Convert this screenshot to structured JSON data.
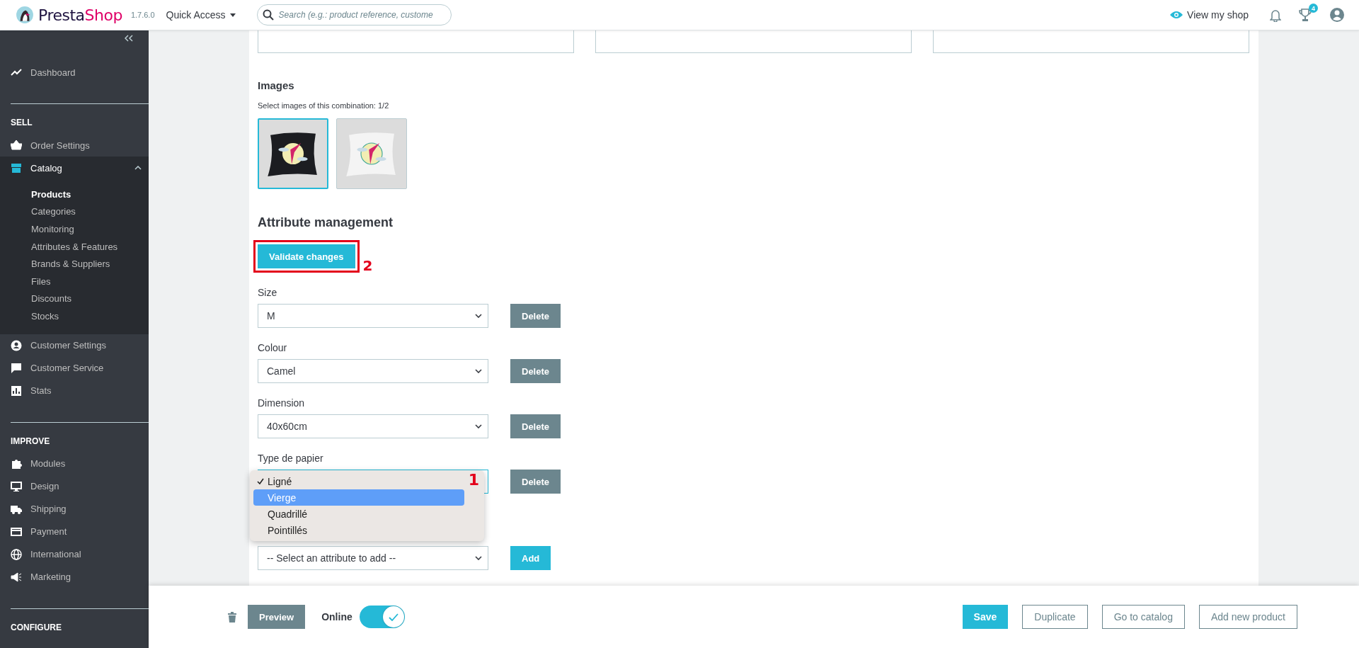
{
  "header": {
    "brand_first": "Presta",
    "brand_second": "Shop",
    "version": "1.7.6.0",
    "quick_access": "Quick Access",
    "search": {
      "placeholder": "Search (e.g.: product reference, custome"
    },
    "view_shop": "View my shop",
    "notification_count": "4"
  },
  "sidebar": {
    "groups": [
      {
        "items": [
          {
            "label": "Dashboard",
            "selected": false
          }
        ]
      },
      {
        "title": "SELL",
        "items": [
          {
            "label": "Order Settings",
            "selected": false
          },
          {
            "label": "Catalog",
            "selected": true,
            "expanded": true,
            "children": [
              {
                "label": "Products",
                "selected": true
              },
              {
                "label": "Categories",
                "selected": false
              },
              {
                "label": "Monitoring",
                "selected": false
              },
              {
                "label": "Attributes & Features",
                "selected": false
              },
              {
                "label": "Brands & Suppliers",
                "selected": false
              },
              {
                "label": "Files",
                "selected": false
              },
              {
                "label": "Discounts",
                "selected": false
              },
              {
                "label": "Stocks",
                "selected": false
              }
            ]
          },
          {
            "label": "Customer Settings",
            "selected": false
          },
          {
            "label": "Customer Service",
            "selected": false
          },
          {
            "label": "Stats",
            "selected": false
          }
        ]
      },
      {
        "title": "IMPROVE",
        "items": [
          {
            "label": "Modules",
            "selected": false
          },
          {
            "label": "Design",
            "selected": false
          },
          {
            "label": "Shipping",
            "selected": false
          },
          {
            "label": "Payment",
            "selected": false
          },
          {
            "label": "International",
            "selected": false
          },
          {
            "label": "Marketing",
            "selected": false
          }
        ]
      },
      {
        "title": "CONFIGURE"
      }
    ]
  },
  "images": {
    "title": "Images",
    "subtitle": "Select images of this combination: 1/2",
    "items": [
      {
        "kind": "picture",
        "selected": true
      },
      {
        "kind": "picture",
        "selected": false
      }
    ]
  },
  "attributes": {
    "title": "Attribute management",
    "validate_button": {
      "label": "Validate changes",
      "outlined": true,
      "annotation": "2"
    },
    "rows": [
      {
        "label": "Size",
        "value": "M",
        "delete": "Delete"
      },
      {
        "label": "Colour",
        "value": "Camel",
        "delete": "Delete"
      },
      {
        "label": "Dimension",
        "value": "40x60cm",
        "delete": "Delete"
      },
      {
        "label": "Type de papier",
        "delete": "Delete",
        "dropdown": {
          "annotation": "1",
          "options": [
            {
              "label": "Ligné",
              "checked": true,
              "highlighted": false
            },
            {
              "label": "Vierge",
              "checked": false,
              "highlighted": true
            },
            {
              "label": "Quadrillé",
              "checked": false,
              "highlighted": false
            },
            {
              "label": "Pointillés",
              "checked": false,
              "highlighted": false
            }
          ]
        }
      }
    ],
    "add": {
      "value": "-- Select an attribute to add --",
      "button": "Add"
    }
  },
  "footer": {
    "preview": "Preview",
    "online_label": "Online",
    "online": true,
    "buttons": [
      {
        "label": "Save",
        "kind": "primary"
      },
      {
        "label": "Duplicate",
        "kind": "outline"
      },
      {
        "label": "Go to catalog",
        "kind": "outline"
      },
      {
        "label": "Add new product",
        "kind": "outline"
      }
    ]
  }
}
